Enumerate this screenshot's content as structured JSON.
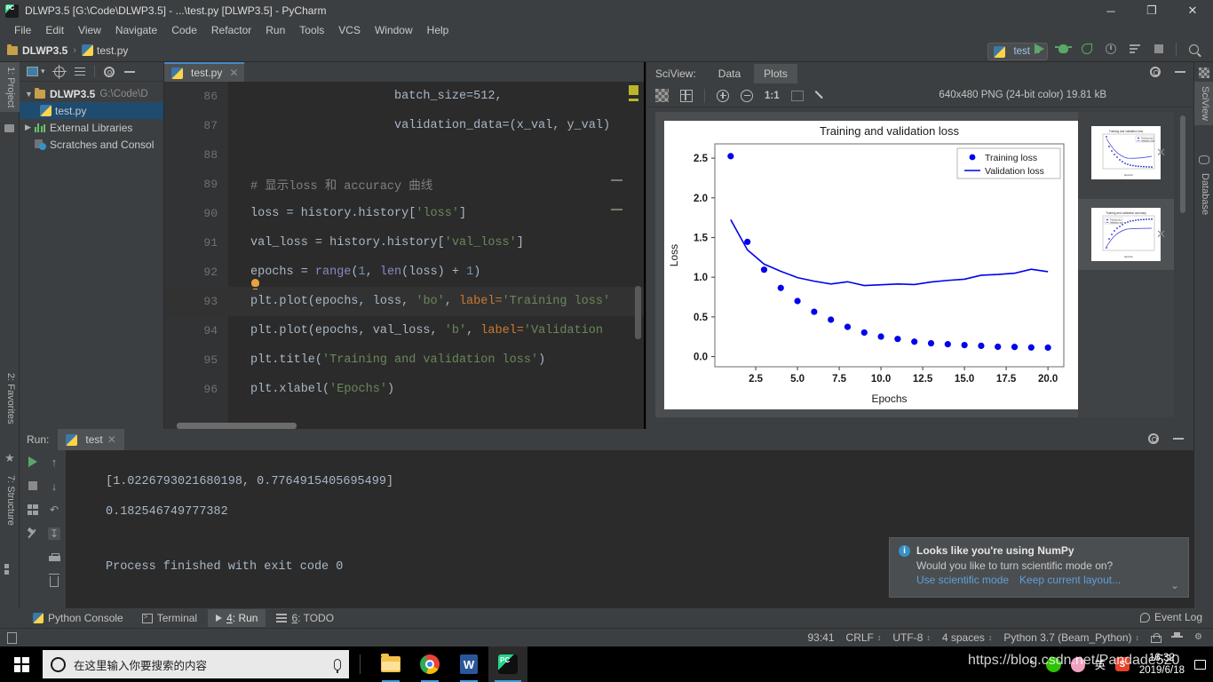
{
  "window": {
    "title": "DLWP3.5 [G:\\Code\\DLWP3.5] - ...\\test.py [DLWP3.5] - PyCharm",
    "minimize": "─",
    "maximize": "❐",
    "close": "✕"
  },
  "menu": [
    "File",
    "Edit",
    "View",
    "Navigate",
    "Code",
    "Refactor",
    "Run",
    "Tools",
    "VCS",
    "Window",
    "Help"
  ],
  "breadcrumb": {
    "project": "DLWP3.5",
    "separator": "›",
    "file": "test.py"
  },
  "toolbar": {
    "run_config": "test",
    "icons": [
      "run-icon",
      "debug-icon",
      "coverage-icon",
      "profile-icon",
      "run-with-params-icon",
      "stop-icon",
      "search-everywhere-icon"
    ]
  },
  "left_strip": {
    "project_tab": "1: Project",
    "favorites_tab": "2: Favorites",
    "structure_tab": "7: Structure"
  },
  "right_strip": {
    "sciview_tab": "SciView",
    "database_tab": "Database"
  },
  "project": {
    "toolbar_icons": [
      "select-opened-file-icon",
      "scroll-from-source-icon",
      "collapse-all-icon",
      "settings-icon",
      "hide-icon"
    ],
    "tree": [
      {
        "label": "DLWP3.5",
        "path": "G:\\Code\\D",
        "icon": "folder-icon",
        "expanded": true,
        "bold": true,
        "selected": false,
        "indent": 0
      },
      {
        "label": "test.py",
        "path": "",
        "icon": "python-file-icon",
        "expanded": null,
        "bold": false,
        "selected": true,
        "indent": 1
      },
      {
        "label": "External Libraries",
        "path": "",
        "icon": "library-icon",
        "expanded": false,
        "bold": false,
        "selected": false,
        "indent": 0
      },
      {
        "label": "Scratches and Consol",
        "path": "",
        "icon": "scratches-icon",
        "expanded": null,
        "bold": false,
        "selected": false,
        "indent": 0
      }
    ]
  },
  "editor": {
    "tab": {
      "label": "test.py",
      "close": "✕"
    },
    "lines": [
      {
        "num": "86",
        "segments": [
          {
            "t": "                    batch_size=512,",
            "c": "k-plain"
          }
        ],
        "current": false
      },
      {
        "num": "87",
        "segments": [
          {
            "t": "                    validation_data=(x_val, y_val)",
            "c": "k-plain"
          }
        ],
        "current": false
      },
      {
        "num": "88",
        "segments": [
          {
            "t": "",
            "c": "k-plain"
          }
        ],
        "current": false
      },
      {
        "num": "89",
        "segments": [
          {
            "t": "# 显示loss 和 accuracy 曲线",
            "c": "k-comment"
          }
        ],
        "current": false
      },
      {
        "num": "90",
        "segments": [
          {
            "t": "loss = history.history[",
            "c": "k-plain"
          },
          {
            "t": "'loss'",
            "c": "k-str"
          },
          {
            "t": "]",
            "c": "k-plain"
          }
        ],
        "current": false
      },
      {
        "num": "91",
        "segments": [
          {
            "t": "val_loss = history.history[",
            "c": "k-plain"
          },
          {
            "t": "'val_loss'",
            "c": "k-str"
          },
          {
            "t": "]",
            "c": "k-plain"
          }
        ],
        "current": false
      },
      {
        "num": "92",
        "segments": [
          {
            "t": "epochs = ",
            "c": "k-plain"
          },
          {
            "t": "range",
            "c": "k-builtin"
          },
          {
            "t": "(",
            "c": "k-plain"
          },
          {
            "t": "1",
            "c": "k-num"
          },
          {
            "t": ", ",
            "c": "k-plain"
          },
          {
            "t": "len",
            "c": "k-builtin"
          },
          {
            "t": "(loss) + ",
            "c": "k-plain"
          },
          {
            "t": "1",
            "c": "k-num"
          },
          {
            "t": ")",
            "c": "k-plain"
          }
        ],
        "current": false
      },
      {
        "num": "93",
        "segments": [
          {
            "t": "plt.plot(epochs, loss, ",
            "c": "k-plain"
          },
          {
            "t": "'bo'",
            "c": "k-str"
          },
          {
            "t": ", ",
            "c": "k-plain"
          },
          {
            "t": "label=",
            "c": "k-named"
          },
          {
            "t": "'Training loss'",
            "c": "k-str"
          }
        ],
        "current": true
      },
      {
        "num": "94",
        "segments": [
          {
            "t": "plt.plot(epochs, val_loss, ",
            "c": "k-plain"
          },
          {
            "t": "'b'",
            "c": "k-str"
          },
          {
            "t": ", ",
            "c": "k-plain"
          },
          {
            "t": "label=",
            "c": "k-named"
          },
          {
            "t": "'Validation",
            "c": "k-str"
          }
        ],
        "current": false
      },
      {
        "num": "95",
        "segments": [
          {
            "t": "plt.title(",
            "c": "k-plain"
          },
          {
            "t": "'Training and validation loss'",
            "c": "k-str"
          },
          {
            "t": ")",
            "c": "k-plain"
          }
        ],
        "current": false
      },
      {
        "num": "96",
        "segments": [
          {
            "t": "plt.xlabel(",
            "c": "k-plain"
          },
          {
            "t": "'Epochs'",
            "c": "k-str"
          },
          {
            "t": ")",
            "c": "k-plain"
          }
        ],
        "current": false
      }
    ]
  },
  "sciview": {
    "title": "SciView:",
    "tabs": [
      {
        "label": "Data",
        "selected": false
      },
      {
        "label": "Plots",
        "selected": true
      }
    ],
    "settings_icon": "gear-icon",
    "hide_icon": "minimize-icon",
    "toolbar": {
      "transparency": "checkerboard-icon",
      "grid": "grid-icon",
      "zoom_in": "zoom-in-icon",
      "zoom_out": "zoom-out-icon",
      "actual_size": "1:1",
      "fit": "fit-to-window-icon",
      "color_picker": "eyedropper-icon"
    },
    "image_info": "640x480 PNG (24-bit color) 19.81 kB",
    "thumbnails": [
      {
        "name": "loss-plot-thumbnail",
        "selected": false,
        "close": "✕"
      },
      {
        "name": "accuracy-plot-thumbnail",
        "selected": true,
        "close": "✕"
      }
    ]
  },
  "chart_data": {
    "type": "scatter",
    "title": "Training and validation loss",
    "xlabel": "Epochs",
    "ylabel": "Loss",
    "xlim": [
      0.05,
      20.95
    ],
    "ylim": [
      -0.128,
      2.68
    ],
    "xticks": [
      2.5,
      5.0,
      7.5,
      10.0,
      12.5,
      15.0,
      17.5,
      20.0
    ],
    "xtick_labels": [
      "2.5",
      "5.0",
      "7.5",
      "10.0",
      "12.5",
      "15.0",
      "17.5",
      "20.0"
    ],
    "yticks": [
      0.0,
      0.5,
      1.0,
      1.5,
      2.0,
      2.5
    ],
    "ytick_labels": [
      "0.0",
      "0.5",
      "1.0",
      "1.5",
      "2.0",
      "2.5"
    ],
    "grid": false,
    "legend_position": "upper right",
    "x": [
      1,
      2,
      3,
      4,
      5,
      6,
      7,
      8,
      9,
      10,
      11,
      12,
      13,
      14,
      15,
      16,
      17,
      18,
      19,
      20
    ],
    "series": [
      {
        "name": "Training loss",
        "style": "markers",
        "color": "#0000ee",
        "values": [
          2.525,
          1.445,
          1.095,
          0.865,
          0.7,
          0.565,
          0.465,
          0.375,
          0.303,
          0.252,
          0.222,
          0.188,
          0.168,
          0.156,
          0.145,
          0.136,
          0.124,
          0.122,
          0.115,
          0.113
        ]
      },
      {
        "name": "Validation loss",
        "style": "line",
        "color": "#0000ee",
        "values": [
          1.725,
          1.345,
          1.165,
          1.075,
          0.995,
          0.95,
          0.915,
          0.943,
          0.895,
          0.905,
          0.915,
          0.908,
          0.94,
          0.96,
          0.975,
          1.025,
          1.035,
          1.05,
          1.1,
          1.07
        ]
      }
    ]
  },
  "run_panel": {
    "label": "Run:",
    "tab": "test",
    "tab_close": "✕",
    "settings_icon": "gear-icon",
    "hide_icon": "minimize-icon",
    "console_lines": [
      "[1.0226793021680198, 0.7764915405695499]",
      "0.182546749777382",
      "",
      "Process finished with exit code 0"
    ],
    "sidebar_icons": [
      "rerun-icon",
      "stop-icon",
      "up-arrow-icon",
      "down-arrow-icon",
      "soft-wrap-icon",
      "scroll-to-end-icon",
      "print-icon",
      "clear-all-icon",
      "pin-icon",
      "layout-icon"
    ]
  },
  "notification": {
    "icon": "info-icon",
    "title": "Looks like you're using NumPy",
    "body": "Would you like to turn scientific mode on?",
    "link_primary": "Use scientific mode",
    "link_secondary": "Keep current layout...",
    "chevron": "⌄"
  },
  "bottom_tabs": [
    {
      "label": "Python Console",
      "icon": "python-icon",
      "selected": false,
      "mnemonic": ""
    },
    {
      "label": "Terminal",
      "icon": "terminal-icon",
      "selected": false,
      "mnemonic": ""
    },
    {
      "label": "Run",
      "icon": "run-icon",
      "selected": true,
      "mnemonic": "4"
    },
    {
      "label": "TODO",
      "icon": "todo-icon",
      "selected": false,
      "mnemonic": "6"
    }
  ],
  "event_log": "Event Log",
  "status_bar": {
    "caret_position": "93:41",
    "line_separator": "CRLF",
    "encoding": "UTF-8",
    "indent": "4 spaces",
    "interpreter": "Python 3.7 (Beam_Python)",
    "chevron": "↕",
    "icons": [
      "lock-icon",
      "inspector-icon",
      "settings-help-icon"
    ]
  },
  "taskbar": {
    "start": "windows-logo-icon",
    "search_placeholder": "在这里输入你要搜索的内容",
    "mic": "microphone-icon",
    "apps": [
      {
        "name": "file-explorer-icon",
        "open": true,
        "active": false
      },
      {
        "name": "chrome-icon",
        "open": true,
        "active": false
      },
      {
        "name": "word-icon",
        "open": true,
        "active": false
      },
      {
        "name": "pycharm-icon",
        "open": false,
        "active": true
      }
    ],
    "tray_chevron": "⌃",
    "tray_icons": [
      "wechat-icon",
      "qq-icon",
      "sogou-icon"
    ],
    "ime": "英",
    "time": "16:32",
    "date": "2019/6/18",
    "notification": "notification-center-icon"
  },
  "watermark": "https://blog.csdn.net/Pandade520"
}
